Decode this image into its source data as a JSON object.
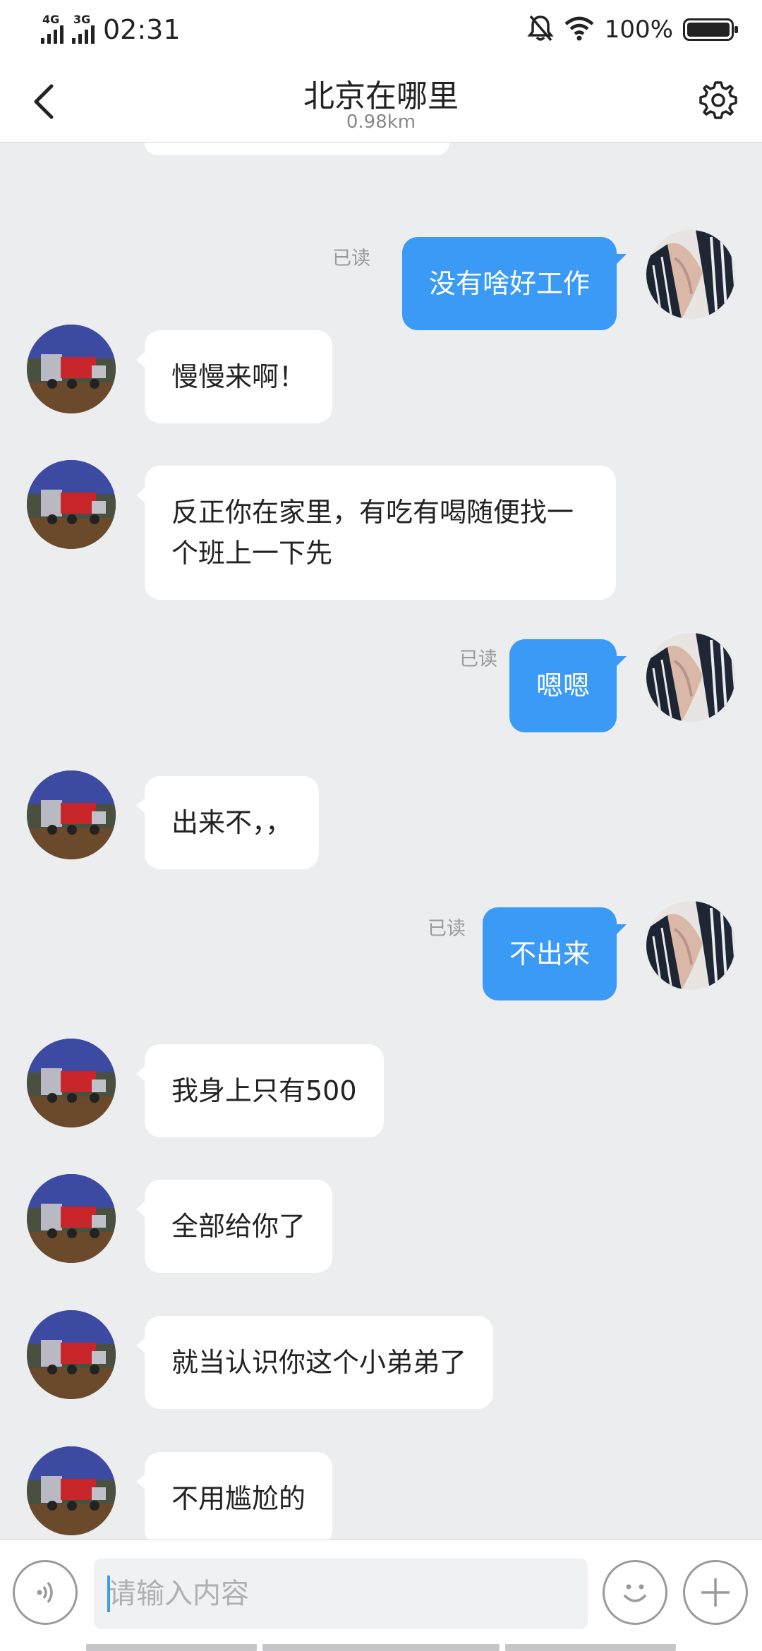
{
  "status_bar": {
    "network_1": "4G",
    "network_2": "3G",
    "time": "02:31",
    "battery": "100%",
    "icons": [
      "signal-icon",
      "mute-bell-icon",
      "wifi-icon",
      "battery-icon"
    ]
  },
  "header": {
    "title": "北京在哪里",
    "distance": "0.98km",
    "back_icon": "chevron-left-icon",
    "settings_icon": "gear-icon"
  },
  "messages": [
    {
      "side": "out",
      "text": "没有啥好工作",
      "status": "已读"
    },
    {
      "side": "in",
      "text": "慢慢来啊！"
    },
    {
      "side": "in",
      "text": "反正你在家里，有吃有喝随便找一个班上一下先"
    },
    {
      "side": "out",
      "text": "嗯嗯",
      "status": "已读"
    },
    {
      "side": "in",
      "text": "出来不，，"
    },
    {
      "side": "out",
      "text": "不出来",
      "status": "已读"
    },
    {
      "side": "in",
      "text": "我身上只有500"
    },
    {
      "side": "in",
      "text": "全部给你了"
    },
    {
      "side": "in",
      "text": "就当认识你这个小弟弟了"
    },
    {
      "side": "in",
      "text": "不用尴尬的"
    }
  ],
  "input_bar": {
    "placeholder": "请输入内容",
    "value": "",
    "voice_icon": "voice-icon",
    "emoji_icon": "emoji-icon",
    "plus_icon": "plus-icon"
  },
  "colors": {
    "outgoing_bubble": "#3a9af6",
    "incoming_bubble": "#ffffff",
    "chat_background": "#ecedef"
  }
}
